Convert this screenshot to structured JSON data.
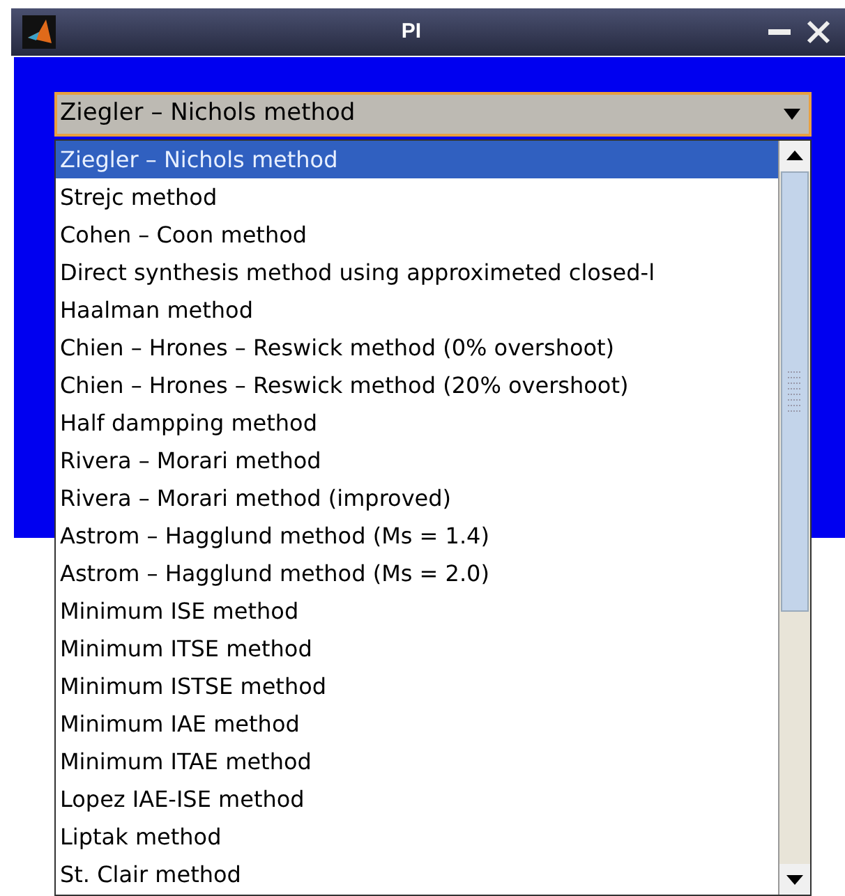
{
  "window": {
    "title": "PI"
  },
  "combo": {
    "value": "Ziegler – Nichols method"
  },
  "list": {
    "items": [
      {
        "label": "Ziegler – Nichols method",
        "selected": true
      },
      {
        "label": "Strejc method",
        "selected": false
      },
      {
        "label": "Cohen – Coon method",
        "selected": false
      },
      {
        "label": "Direct synthesis method using approximeted closed-l",
        "selected": false
      },
      {
        "label": "Haalman method",
        "selected": false
      },
      {
        "label": "Chien – Hrones – Reswick method (0% overshoot)",
        "selected": false
      },
      {
        "label": "Chien – Hrones – Reswick method (20% overshoot)",
        "selected": false
      },
      {
        "label": "Half dampping method",
        "selected": false
      },
      {
        "label": "Rivera – Morari method",
        "selected": false
      },
      {
        "label": "Rivera – Morari method (improved)",
        "selected": false
      },
      {
        "label": "Astrom – Hagglund method (Ms = 1.4)",
        "selected": false
      },
      {
        "label": "Astrom – Hagglund method (Ms = 2.0)",
        "selected": false
      },
      {
        "label": "Minimum ISE method",
        "selected": false
      },
      {
        "label": "Minimum ITSE method",
        "selected": false
      },
      {
        "label": "Minimum ISTSE method",
        "selected": false
      },
      {
        "label": "Minimum IAE method",
        "selected": false
      },
      {
        "label": "Minimum ITAE method",
        "selected": false
      },
      {
        "label": "Lopez IAE-ISE method",
        "selected": false
      },
      {
        "label": "Liptak method",
        "selected": false
      },
      {
        "label": "St. Clair method",
        "selected": false
      }
    ]
  }
}
